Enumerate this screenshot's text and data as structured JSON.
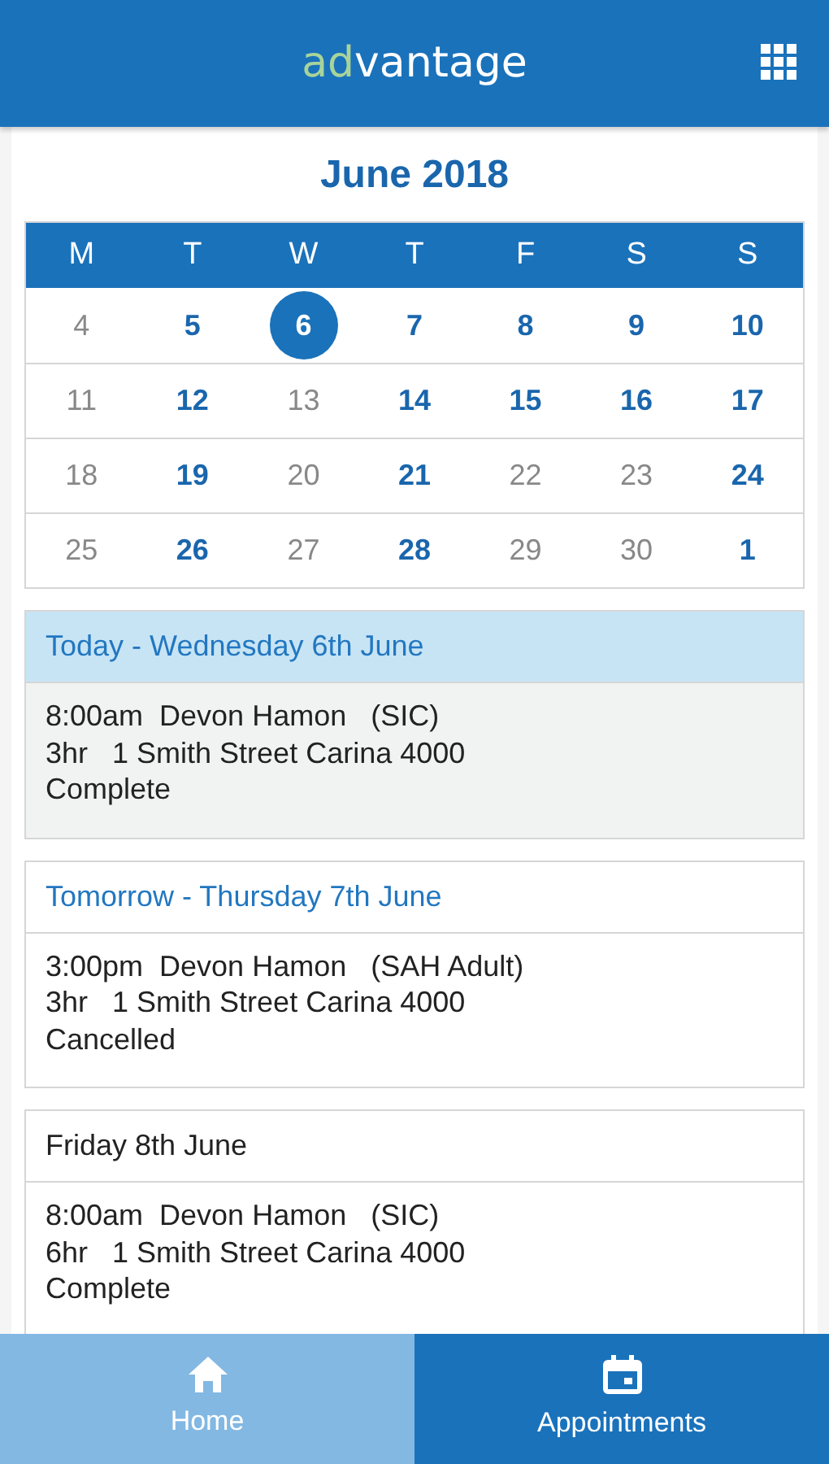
{
  "header": {
    "logo": [
      {
        "text": "ad",
        "kind": "accent"
      },
      {
        "text": "vantage",
        "kind": "plain"
      }
    ]
  },
  "calendar": {
    "title": "June 2018",
    "weekdays": [
      "M",
      "T",
      "W",
      "T",
      "F",
      "S",
      "S"
    ],
    "weeks": [
      [
        {
          "day": "4",
          "busy": false,
          "selected": false
        },
        {
          "day": "5",
          "busy": true,
          "selected": false
        },
        {
          "day": "6",
          "busy": true,
          "selected": true
        },
        {
          "day": "7",
          "busy": true,
          "selected": false
        },
        {
          "day": "8",
          "busy": true,
          "selected": false
        },
        {
          "day": "9",
          "busy": true,
          "selected": false
        },
        {
          "day": "10",
          "busy": true,
          "selected": false
        }
      ],
      [
        {
          "day": "11",
          "busy": false,
          "selected": false
        },
        {
          "day": "12",
          "busy": true,
          "selected": false
        },
        {
          "day": "13",
          "busy": false,
          "selected": false
        },
        {
          "day": "14",
          "busy": true,
          "selected": false
        },
        {
          "day": "15",
          "busy": true,
          "selected": false
        },
        {
          "day": "16",
          "busy": true,
          "selected": false
        },
        {
          "day": "17",
          "busy": true,
          "selected": false
        }
      ],
      [
        {
          "day": "18",
          "busy": false,
          "selected": false
        },
        {
          "day": "19",
          "busy": true,
          "selected": false
        },
        {
          "day": "20",
          "busy": false,
          "selected": false
        },
        {
          "day": "21",
          "busy": true,
          "selected": false
        },
        {
          "day": "22",
          "busy": false,
          "selected": false
        },
        {
          "day": "23",
          "busy": false,
          "selected": false
        },
        {
          "day": "24",
          "busy": true,
          "selected": false
        }
      ],
      [
        {
          "day": "25",
          "busy": false,
          "selected": false
        },
        {
          "day": "26",
          "busy": true,
          "selected": false
        },
        {
          "day": "27",
          "busy": false,
          "selected": false
        },
        {
          "day": "28",
          "busy": true,
          "selected": false
        },
        {
          "day": "29",
          "busy": false,
          "selected": false
        },
        {
          "day": "30",
          "busy": false,
          "selected": false
        },
        {
          "day": "1",
          "busy": true,
          "selected": false
        }
      ]
    ]
  },
  "days": [
    {
      "heading": "Today - Wednesday 6th June",
      "kind": "today",
      "appointments": [
        {
          "line_1": "8:00am  Devon Hamon   (SIC)",
          "line_2": "3hr   1 Smith Street Carina 4000",
          "status": "Complete"
        }
      ]
    },
    {
      "heading": "Tomorrow - Thursday 7th June",
      "kind": "tomorrow",
      "appointments": [
        {
          "line_1": "3:00pm  Devon Hamon   (SAH Adult)",
          "line_2": "3hr   1 Smith Street Carina 4000",
          "status": "Cancelled"
        }
      ]
    },
    {
      "heading": "Friday 8th June",
      "kind": "later",
      "appointments": [
        {
          "line_1": "8:00am  Devon Hamon   (SIC)",
          "line_2": "6hr   1 Smith Street Carina 4000",
          "status": "Complete"
        }
      ]
    }
  ],
  "tabs": [
    {
      "label": "Home",
      "kind": "home",
      "selected": false
    },
    {
      "label": "Appointments",
      "kind": "calendar",
      "selected": true
    }
  ]
}
